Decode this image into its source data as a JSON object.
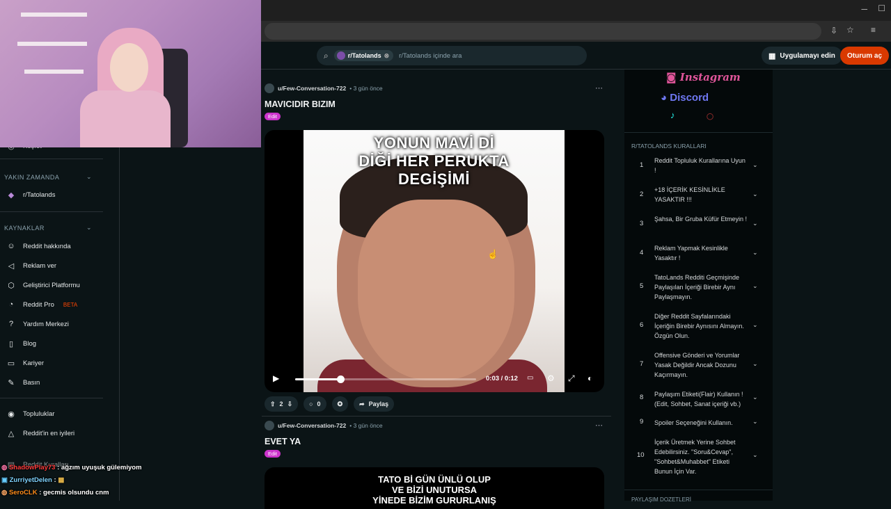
{
  "search": {
    "community_chip": "r/Tatolands",
    "placeholder": "r/Tatolands içinde ara"
  },
  "header": {
    "app_button": "Uygulamayı edin",
    "login_button": "Oturum aç"
  },
  "sidebar": {
    "partial_top_item": "Keşfet",
    "recent_heading": "YAKIN ZAMANDA",
    "recent_items": [
      {
        "label": "r/Tatolands",
        "icon": "community-avatar-icon"
      }
    ],
    "resources_heading": "KAYNAKLAR",
    "resources_items": [
      {
        "label": "Reddit hakkında",
        "icon": "reddit-alien-icon"
      },
      {
        "label": "Reklam ver",
        "icon": "megaphone-icon"
      },
      {
        "label": "Geliştirici Platformu",
        "icon": "developer-icon"
      },
      {
        "label": "Reddit Pro",
        "icon": "pro-icon",
        "badge": "BETA"
      },
      {
        "label": "Yardım Merkezi",
        "icon": "help-icon"
      },
      {
        "label": "Blog",
        "icon": "book-icon"
      },
      {
        "label": "Kariyer",
        "icon": "briefcase-icon"
      },
      {
        "label": "Basın",
        "icon": "pen-icon"
      }
    ],
    "bottom_items": [
      {
        "label": "Topluluklar",
        "icon": "communities-icon"
      },
      {
        "label": "Reddit'in en iyileri",
        "icon": "best-of-icon"
      },
      {
        "label": "Reddit Kuralları",
        "icon": "rules-icon"
      }
    ]
  },
  "posts": [
    {
      "author": "u/Few-Conversation-722",
      "time": "• 3 gün önce",
      "title": "MAVICIDIR BIZIM",
      "flair": "Edit",
      "video_text": [
        "YONUN MAVİ Dİ",
        "DİĞİ HER PERUKTA",
        "DEGİŞİMİ"
      ],
      "timecode": "0:03 / 0:12",
      "progress": 0.25,
      "votes": "2",
      "comments": "0",
      "share": "Paylaş"
    },
    {
      "author": "u/Few-Conversation-722",
      "time": "• 3 gün önce",
      "title": "EVET YA",
      "flair": "Edit",
      "video_text": [
        "TATO Bİ GÜN ÜNLÜ OLUP",
        "VE BİZİ UNUTURSA",
        "YİNEDE BİZİM GURURLANIŞ"
      ]
    }
  ],
  "right_panel": {
    "social_links": [
      "Instagram",
      "Discord"
    ],
    "rules_heading": "R/TATOLANDS KURALLARI",
    "rules": [
      {
        "num": "1",
        "text": "Reddit Topluluk Kurallarına Uyun !"
      },
      {
        "num": "2",
        "text": "+18 İÇERİK KESİNLİKLE YASAKTIR !!!"
      },
      {
        "num": "3",
        "text": "Şahsa, Bir Gruba Küfür Etmeyin !"
      },
      {
        "num": "4",
        "text": "Reklam Yapmak Kesinlikle Yasaktır !"
      },
      {
        "num": "5",
        "text": "TatoLands Redditi Geçmişinde Paylaşılan İçeriği Birebir Aynı Paylaşmayın."
      },
      {
        "num": "6",
        "text": "Diğer Reddit Sayfalarındaki İçeriğin Birebir Aynısını Almayın. Özgün Olun."
      },
      {
        "num": "7",
        "text": "Offensive Gönderi ve Yorumlar Yasak Değildir Ancak Dozunu Kaçırmayın."
      },
      {
        "num": "8",
        "text": "Paylaşım Etiketi(Flair) Kullanın ! (Edit, Sohbet, Sanat içeriği vb.)"
      },
      {
        "num": "9",
        "text": "Spoiler Seçeneğini Kullanın."
      },
      {
        "num": "10",
        "text": "İçerik Üretmek Yerine Sohbet Edebilirsiniz. \"Soru&Cevap\", \"Sohbet&Muhabbet\" Etiketi Bunun İçin Var."
      }
    ],
    "footer_partial": "PAYLAŞIM DOZETLERİ"
  },
  "chat": [
    {
      "user": "ShadowPlay73",
      "message": ": ağzım uyuşuk gülemiyom",
      "color": "#ff3b3b"
    },
    {
      "user": "ZurriyetDelen",
      "message": ":",
      "color": "#7fd3ff"
    },
    {
      "user": "SeroCLK",
      "message": ": gecmis olsundu cnm",
      "color": "#ff8c1a"
    }
  ],
  "colors": {
    "accent": "#d93900",
    "flair": "#cc33cc",
    "background": "#0b1416"
  }
}
